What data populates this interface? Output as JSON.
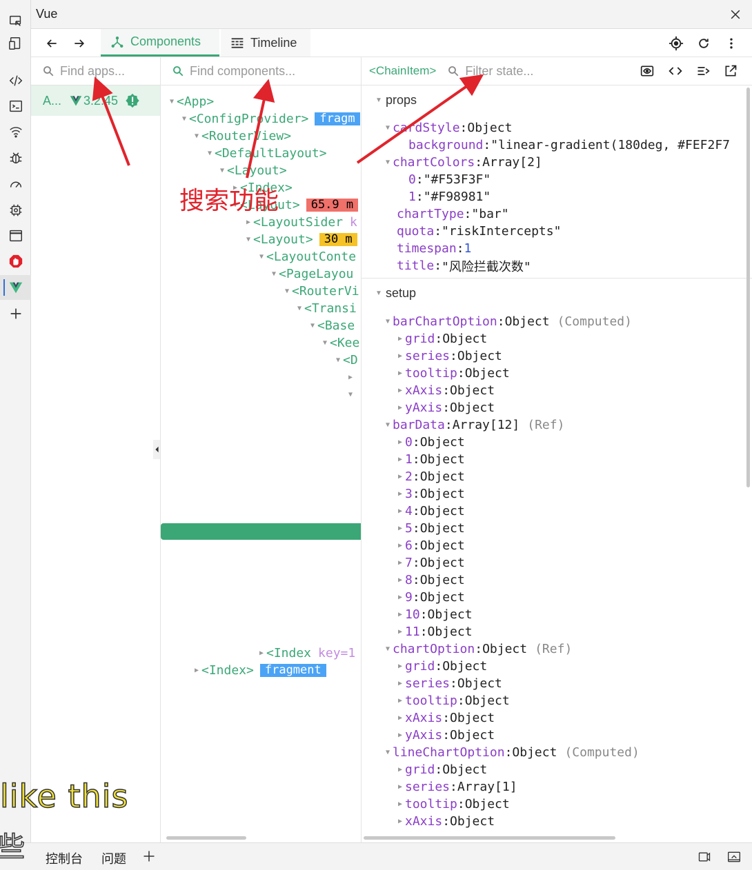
{
  "window": {
    "title": "Vue"
  },
  "toolbar": {
    "tab_components": "Components",
    "tab_timeline": "Timeline"
  },
  "apps": {
    "placeholder": "Find apps...",
    "app_name": "A...",
    "version": "3.2.45"
  },
  "tree": {
    "placeholder": "Find components...",
    "rows": [
      {
        "text": "<App>"
      },
      {
        "text": "<ConfigProvider>",
        "badge": "fragm"
      },
      {
        "text": "<RouterView>"
      },
      {
        "text": "<DefaultLayout>"
      },
      {
        "text": "<Layout>"
      },
      {
        "text": "<Index>"
      },
      {
        "text": "<Layout>",
        "badge": "65.9 m"
      },
      {
        "text": "<LayoutSider",
        "attr": "k"
      },
      {
        "text": "<Layout>",
        "badge": "30 m"
      },
      {
        "text": "<LayoutConte"
      },
      {
        "text": "<PageLayou"
      },
      {
        "text": "<RouterVi"
      },
      {
        "text": "<Transi"
      },
      {
        "text": "<Base"
      },
      {
        "text": "<Kee"
      },
      {
        "text": "<D"
      },
      {
        "text": "<Index",
        "attr": "key=1"
      },
      {
        "text": "<Index>",
        "badge": "fragment"
      }
    ]
  },
  "state": {
    "selected": "<ChainItem>",
    "placeholder": "Filter state...",
    "props_label": "props",
    "props": {
      "cardStyle": {
        "key": "cardStyle",
        "value": "Object"
      },
      "background": {
        "key": "background",
        "value": "\"linear-gradient(180deg, #FEF2F7"
      },
      "chartColors": {
        "key": "chartColors",
        "value": "Array[2]"
      },
      "c0": {
        "key": "0",
        "value": "\"#F53F3F\""
      },
      "c1": {
        "key": "1",
        "value": "\"#F98981\""
      },
      "chartType": {
        "key": "chartType",
        "value": "\"bar\""
      },
      "quota": {
        "key": "quota",
        "value": "\"riskIntercepts\""
      },
      "timespan": {
        "key": "timespan",
        "value": "1"
      },
      "title": {
        "key": "title",
        "value": "\"风险拦截次数\""
      }
    },
    "setup_label": "setup",
    "setup": {
      "barChartOption": {
        "key": "barChartOption",
        "value": "Object",
        "tag": "(Computed)",
        "children": [
          {
            "key": "grid",
            "value": "Object"
          },
          {
            "key": "series",
            "value": "Object"
          },
          {
            "key": "tooltip",
            "value": "Object"
          },
          {
            "key": "xAxis",
            "value": "Object"
          },
          {
            "key": "yAxis",
            "value": "Object"
          }
        ]
      },
      "barData": {
        "key": "barData",
        "value": "Array[12]",
        "tag": "(Ref)",
        "children": [
          {
            "key": "0",
            "value": "Object"
          },
          {
            "key": "1",
            "value": "Object"
          },
          {
            "key": "2",
            "value": "Object"
          },
          {
            "key": "3",
            "value": "Object"
          },
          {
            "key": "4",
            "value": "Object"
          },
          {
            "key": "5",
            "value": "Object"
          },
          {
            "key": "6",
            "value": "Object"
          },
          {
            "key": "7",
            "value": "Object"
          },
          {
            "key": "8",
            "value": "Object"
          },
          {
            "key": "9",
            "value": "Object"
          },
          {
            "key": "10",
            "value": "Object"
          },
          {
            "key": "11",
            "value": "Object"
          }
        ]
      },
      "chartOption": {
        "key": "chartOption",
        "value": "Object",
        "tag": "(Ref)",
        "children": [
          {
            "key": "grid",
            "value": "Object"
          },
          {
            "key": "series",
            "value": "Object"
          },
          {
            "key": "tooltip",
            "value": "Object"
          },
          {
            "key": "xAxis",
            "value": "Object"
          },
          {
            "key": "yAxis",
            "value": "Object"
          }
        ]
      },
      "lineChartOption": {
        "key": "lineChartOption",
        "value": "Object",
        "tag": "(Computed)",
        "children": [
          {
            "key": "grid",
            "value": "Object"
          },
          {
            "key": "series",
            "value": "Array[1]"
          },
          {
            "key": "tooltip",
            "value": "Object"
          },
          {
            "key": "xAxis",
            "value": "Object"
          }
        ]
      }
    }
  },
  "annotation": {
    "text": "搜索功能",
    "color": "#e0242c"
  },
  "subtitles": {
    "line1": "like this",
    "line2": "些"
  },
  "bottom": {
    "console": "控制台",
    "issues": "问题"
  },
  "colors": {
    "accent": "#3ba776",
    "key": "#8a3ec7",
    "number": "#3355d6"
  }
}
